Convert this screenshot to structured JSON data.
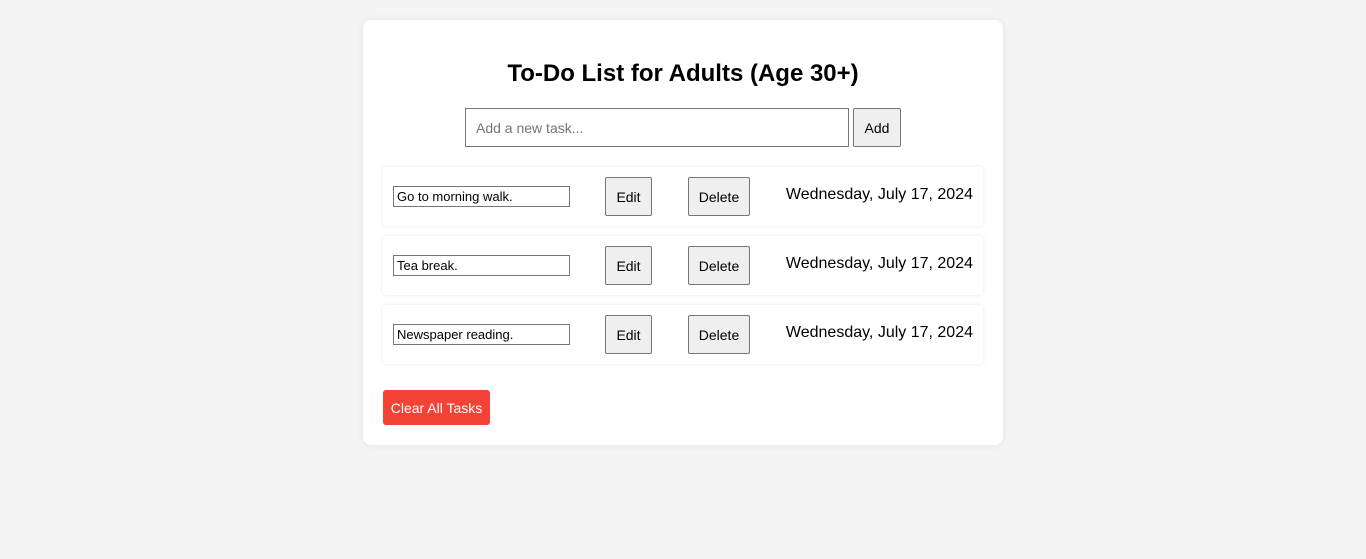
{
  "header": {
    "title": "To-Do List for Adults (Age 30+)"
  },
  "new_task": {
    "placeholder": "Add a new task...",
    "value": "",
    "add_label": "Add"
  },
  "tasks": [
    {
      "text": "Go to morning walk.",
      "edit_label": "Edit",
      "delete_label": "Delete",
      "date": "Wednesday, July 17, 2024"
    },
    {
      "text": "Tea break.",
      "edit_label": "Edit",
      "delete_label": "Delete",
      "date": "Wednesday, July 17, 2024"
    },
    {
      "text": "Newspaper reading.",
      "edit_label": "Edit",
      "delete_label": "Delete",
      "date": "Wednesday, July 17, 2024"
    }
  ],
  "actions": {
    "clear_all_label": "Clear All Tasks"
  },
  "colors": {
    "page_background": "#f4f4f4",
    "card_background": "#ffffff",
    "clear_button": "#f44336"
  }
}
